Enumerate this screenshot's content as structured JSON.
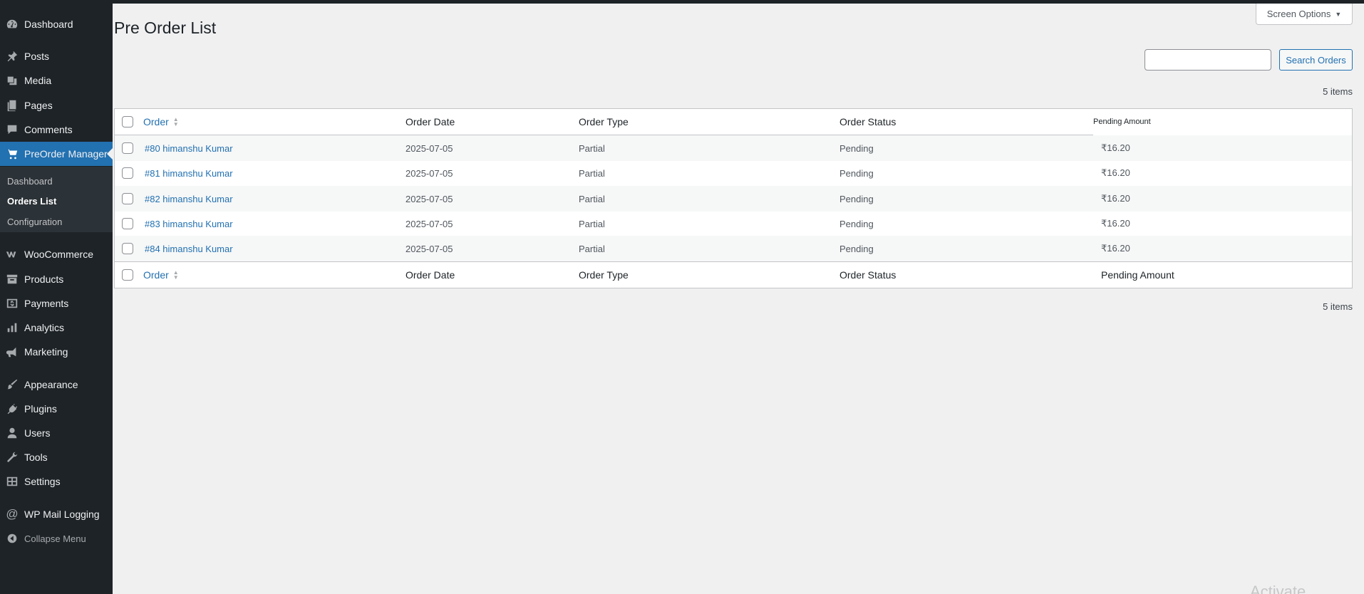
{
  "sidebar": {
    "items": [
      {
        "label": "Dashboard",
        "icon": "dashboard-icon"
      },
      {
        "label": "Posts",
        "icon": "pin-icon"
      },
      {
        "label": "Media",
        "icon": "media-icon"
      },
      {
        "label": "Pages",
        "icon": "pages-icon"
      },
      {
        "label": "Comments",
        "icon": "comment-icon"
      },
      {
        "label": "PreOrder Manager",
        "icon": "cart-icon",
        "active": true
      },
      {
        "label": "WooCommerce",
        "icon": "woocommerce-icon"
      },
      {
        "label": "Products",
        "icon": "archive-icon"
      },
      {
        "label": "Payments",
        "icon": "payment-icon"
      },
      {
        "label": "Analytics",
        "icon": "bar-chart-icon"
      },
      {
        "label": "Marketing",
        "icon": "megaphone-icon"
      },
      {
        "label": "Appearance",
        "icon": "paint-brush-icon"
      },
      {
        "label": "Plugins",
        "icon": "plug-icon"
      },
      {
        "label": "Users",
        "icon": "user-icon"
      },
      {
        "label": "Tools",
        "icon": "wrench-icon"
      },
      {
        "label": "Settings",
        "icon": "settings-icon"
      },
      {
        "label": "WP Mail Logging",
        "icon": "at-sign-icon"
      },
      {
        "label": "Collapse Menu",
        "icon": "collapse-icon"
      }
    ],
    "submenu": [
      "Dashboard",
      "Orders List",
      "Configuration"
    ],
    "current_submenu": "Orders List"
  },
  "header": {
    "title": "Pre Order List",
    "screen_options": "Screen Options"
  },
  "search": {
    "value": "",
    "button_label": "Search Orders"
  },
  "items_count_top": "5 items",
  "items_count_bottom": "5 items",
  "table": {
    "columns": [
      "Order",
      "Order Date",
      "Order Type",
      "Order Status",
      "Pending Amount"
    ],
    "footer_columns": [
      "Order",
      "Order Date",
      "Order Type",
      "Order Status",
      "Pending Amount"
    ],
    "rows": [
      {
        "order": "#80 himanshu Kumar",
        "date": "2025-07-05",
        "type": "Partial",
        "status": "Pending",
        "pending": "₹16.20"
      },
      {
        "order": "#81 himanshu Kumar",
        "date": "2025-07-05",
        "type": "Partial",
        "status": "Pending",
        "pending": "₹16.20"
      },
      {
        "order": "#82 himanshu Kumar",
        "date": "2025-07-05",
        "type": "Partial",
        "status": "Pending",
        "pending": "₹16.20"
      },
      {
        "order": "#83 himanshu Kumar",
        "date": "2025-07-05",
        "type": "Partial",
        "status": "Pending",
        "pending": "₹16.20"
      },
      {
        "order": "#84 himanshu Kumar",
        "date": "2025-07-05",
        "type": "Partial",
        "status": "Pending",
        "pending": "₹16.20"
      }
    ]
  },
  "colors": {
    "sidebar_bg": "#1d2327",
    "accent": "#2271b1",
    "page_bg": "#f0f0f1"
  },
  "watermark": "Activate Windows"
}
